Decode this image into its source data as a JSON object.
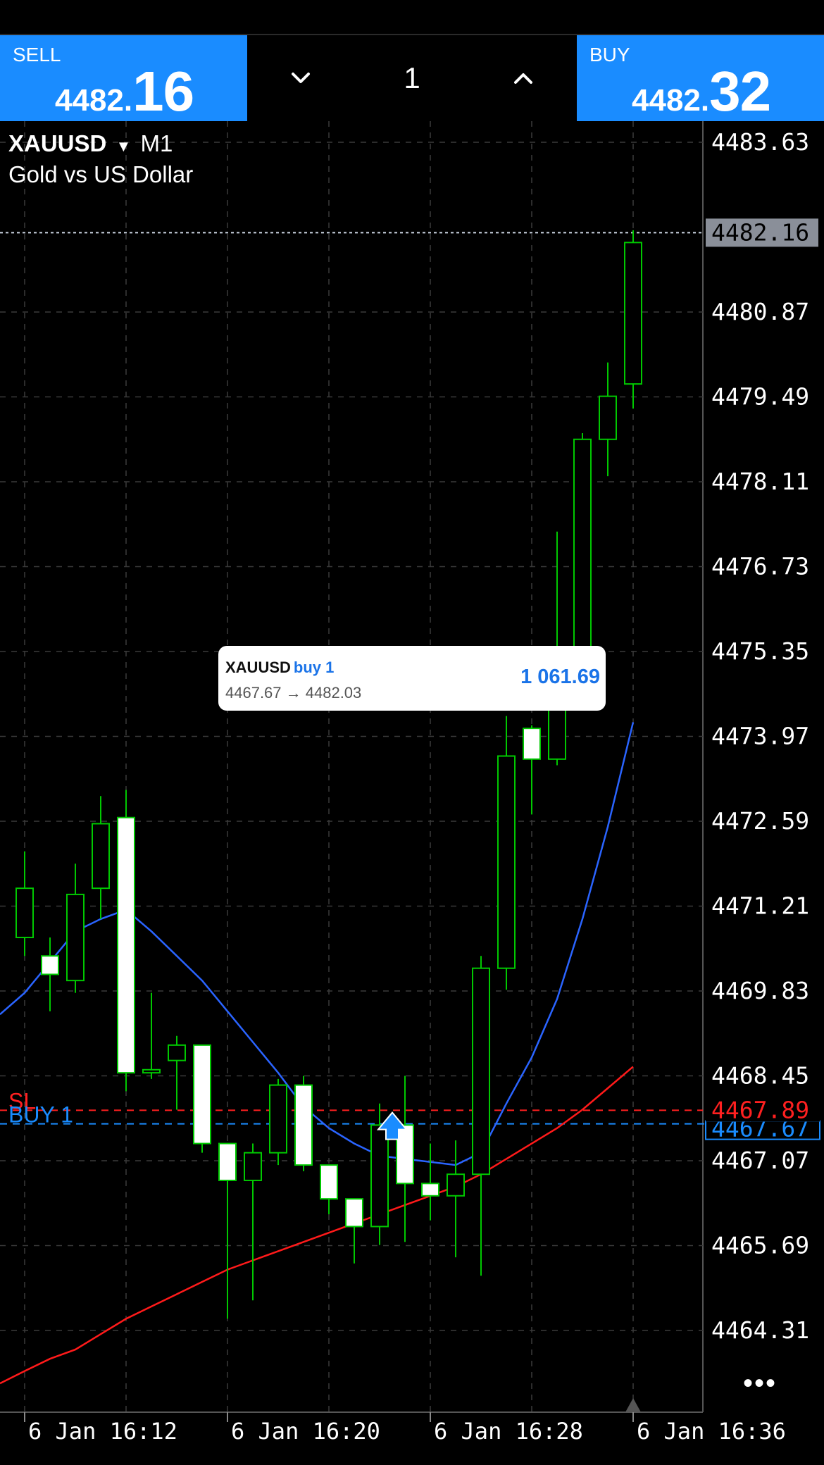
{
  "sell": {
    "label": "SELL",
    "price_small": "4482.",
    "price_big": "16"
  },
  "buy": {
    "label": "BUY",
    "price_small": "4482.",
    "price_big": "32"
  },
  "volume": "1",
  "chart_header": {
    "symbol": "XAUUSD",
    "timeframe": "M1",
    "description": "Gold vs US Dollar"
  },
  "trade_ticket": {
    "symbol": "XAUUSD",
    "type": "buy 1",
    "prices": "4467.67 → 4482.03",
    "profit": "1 061.69"
  },
  "order_lines": {
    "sl_label": "SL",
    "buy_label": "BUY 1",
    "sl_price": "4467.89",
    "buy_price": "4467.67"
  },
  "current_price_tag": "4482.16",
  "colors": {
    "accent": "#1a8cff",
    "bull": "#00c800",
    "sl": "#ff2020",
    "ma_fast": "#2a64ff",
    "ma_slow": "#ff1a1a",
    "grid": "#3a3a3a"
  },
  "chart_data": {
    "type": "candlestick",
    "symbol": "XAUUSD",
    "timeframe": "M1",
    "price_ticks": [
      "4483.63",
      "4480.87",
      "4479.49",
      "4478.11",
      "4476.73",
      "4475.35",
      "4473.97",
      "4472.59",
      "4471.21",
      "4469.83",
      "4468.45",
      "4467.07",
      "4465.69",
      "4464.31"
    ],
    "time_labels": [
      "6 Jan 16:12",
      "6 Jan 16:20",
      "6 Jan 16:28",
      "6 Jan 16:36"
    ],
    "candles": [
      {
        "o": 4470.7,
        "h": 4472.1,
        "l": 4470.4,
        "c": 4471.5
      },
      {
        "o": 4470.4,
        "h": 4470.7,
        "l": 4469.5,
        "c": 4470.1
      },
      {
        "o": 4470.0,
        "h": 4471.9,
        "l": 4469.8,
        "c": 4471.4
      },
      {
        "o": 4471.5,
        "h": 4473.0,
        "l": 4471.0,
        "c": 4472.55
      },
      {
        "o": 4472.65,
        "h": 4473.1,
        "l": 4468.2,
        "c": 4468.5
      },
      {
        "o": 4468.5,
        "h": 4469.8,
        "l": 4468.4,
        "c": 4468.55
      },
      {
        "o": 4468.7,
        "h": 4469.1,
        "l": 4467.9,
        "c": 4468.95
      },
      {
        "o": 4468.95,
        "h": 4468.95,
        "l": 4467.2,
        "c": 4467.35
      },
      {
        "o": 4467.35,
        "h": 4467.35,
        "l": 4464.5,
        "c": 4466.75
      },
      {
        "o": 4466.75,
        "h": 4467.35,
        "l": 4464.8,
        "c": 4467.2
      },
      {
        "o": 4467.2,
        "h": 4468.4,
        "l": 4467.0,
        "c": 4468.3
      },
      {
        "o": 4468.3,
        "h": 4468.45,
        "l": 4466.9,
        "c": 4467.0
      },
      {
        "o": 4467.0,
        "h": 4467.0,
        "l": 4466.2,
        "c": 4466.45
      },
      {
        "o": 4466.45,
        "h": 4466.45,
        "l": 4465.4,
        "c": 4466.0
      },
      {
        "o": 4466.0,
        "h": 4468.0,
        "l": 4465.7,
        "c": 4467.65
      },
      {
        "o": 4467.65,
        "h": 4468.45,
        "l": 4465.75,
        "c": 4466.7
      },
      {
        "o": 4466.7,
        "h": 4467.35,
        "l": 4466.1,
        "c": 4466.5
      },
      {
        "o": 4466.5,
        "h": 4467.4,
        "l": 4465.5,
        "c": 4466.85
      },
      {
        "o": 4466.85,
        "h": 4470.4,
        "l": 4465.2,
        "c": 4470.2
      },
      {
        "o": 4470.2,
        "h": 4474.3,
        "l": 4469.85,
        "c": 4473.65
      },
      {
        "o": 4474.1,
        "h": 4474.15,
        "l": 4472.7,
        "c": 4473.6
      },
      {
        "o": 4473.6,
        "h": 4477.3,
        "l": 4473.5,
        "c": 4474.8
      },
      {
        "o": 4474.8,
        "h": 4478.9,
        "l": 4474.6,
        "c": 4478.8
      },
      {
        "o": 4478.8,
        "h": 4480.05,
        "l": 4478.2,
        "c": 4479.5
      },
      {
        "o": 4479.7,
        "h": 4482.2,
        "l": 4479.3,
        "c": 4482.0
      }
    ],
    "ma_fast": [
      4469.8,
      4470.3,
      4470.8,
      4471.0,
      4471.15,
      4470.8,
      4470.4,
      4470.0,
      4469.5,
      4469.0,
      4468.5,
      4467.95,
      4467.6,
      4467.35,
      4467.15,
      4467.1,
      4467.05,
      4467.0,
      4467.2,
      4468.0,
      4468.75,
      4469.7,
      4471.0,
      4472.5,
      4474.2
    ],
    "ma_slow": [
      4463.65,
      4463.85,
      4464.0,
      4464.25,
      4464.5,
      4464.7,
      4464.9,
      4465.1,
      4465.3,
      4465.45,
      4465.6,
      4465.75,
      4465.9,
      4466.05,
      4466.2,
      4466.35,
      4466.5,
      4466.65,
      4466.85,
      4467.1,
      4467.35,
      4467.6,
      4467.9,
      4468.25,
      4468.6
    ],
    "current_price": 4482.16,
    "buy_entry_price": 4467.67,
    "stop_loss_price": 4467.89,
    "grid": true
  }
}
